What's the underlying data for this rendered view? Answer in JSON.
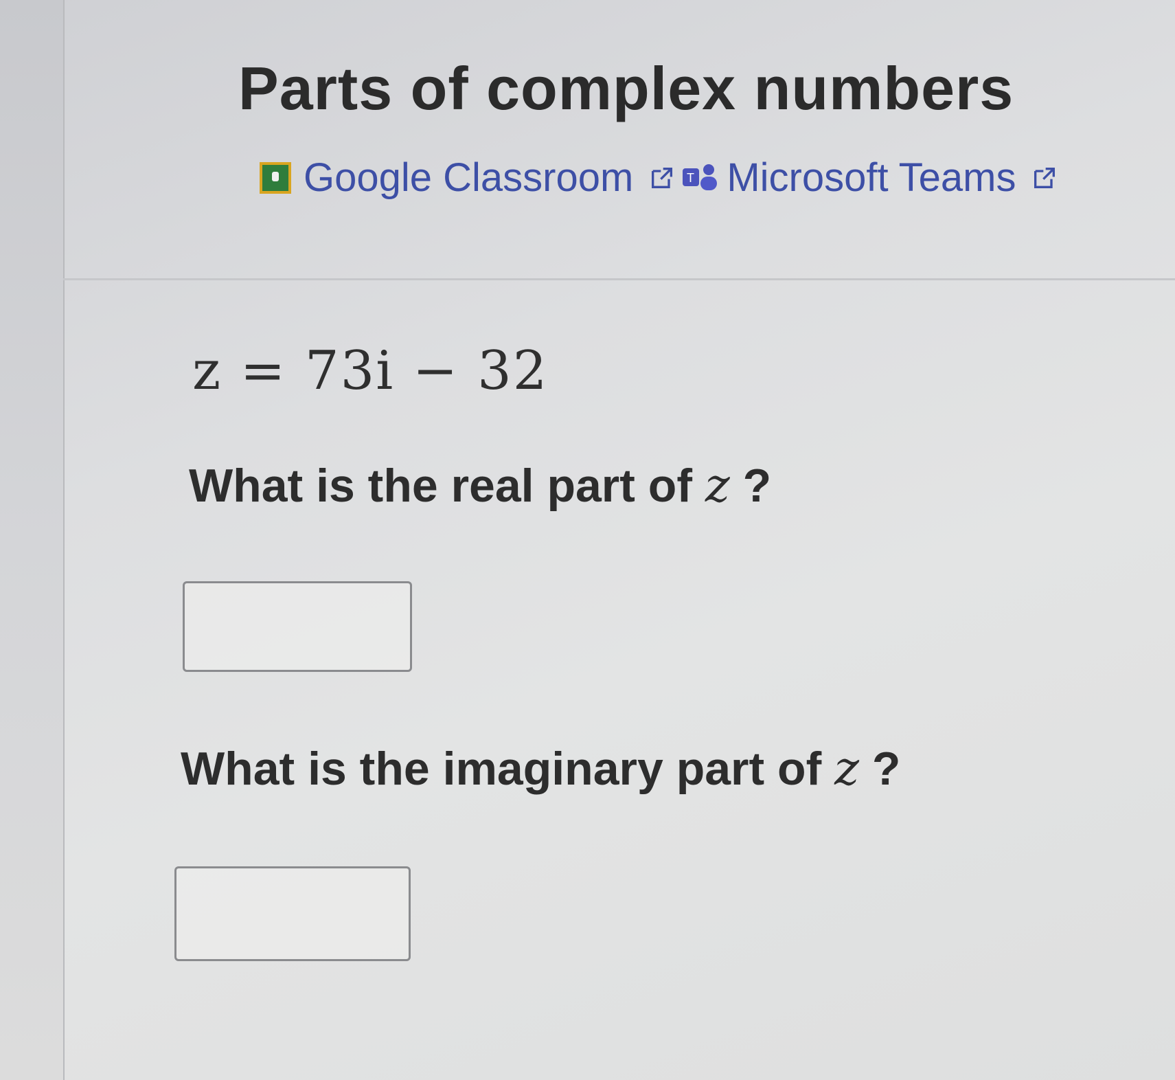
{
  "header": {
    "title": "Parts of complex numbers",
    "share_links": [
      {
        "label": "Google Classroom",
        "icon": "google-classroom-icon"
      },
      {
        "label": "Microsoft Teams",
        "icon": "microsoft-teams-icon"
      }
    ]
  },
  "problem": {
    "equation": "z = 73i − 32"
  },
  "questions": [
    {
      "prefix": "What is the real part of ",
      "variable": "z",
      "suffix": " ?",
      "answer_value": ""
    },
    {
      "prefix": "What is the imaginary part of ",
      "variable": "z",
      "suffix": " ?",
      "answer_value": ""
    }
  ],
  "colors": {
    "link": "#3d4fa6",
    "title": "#2b2b2b"
  }
}
